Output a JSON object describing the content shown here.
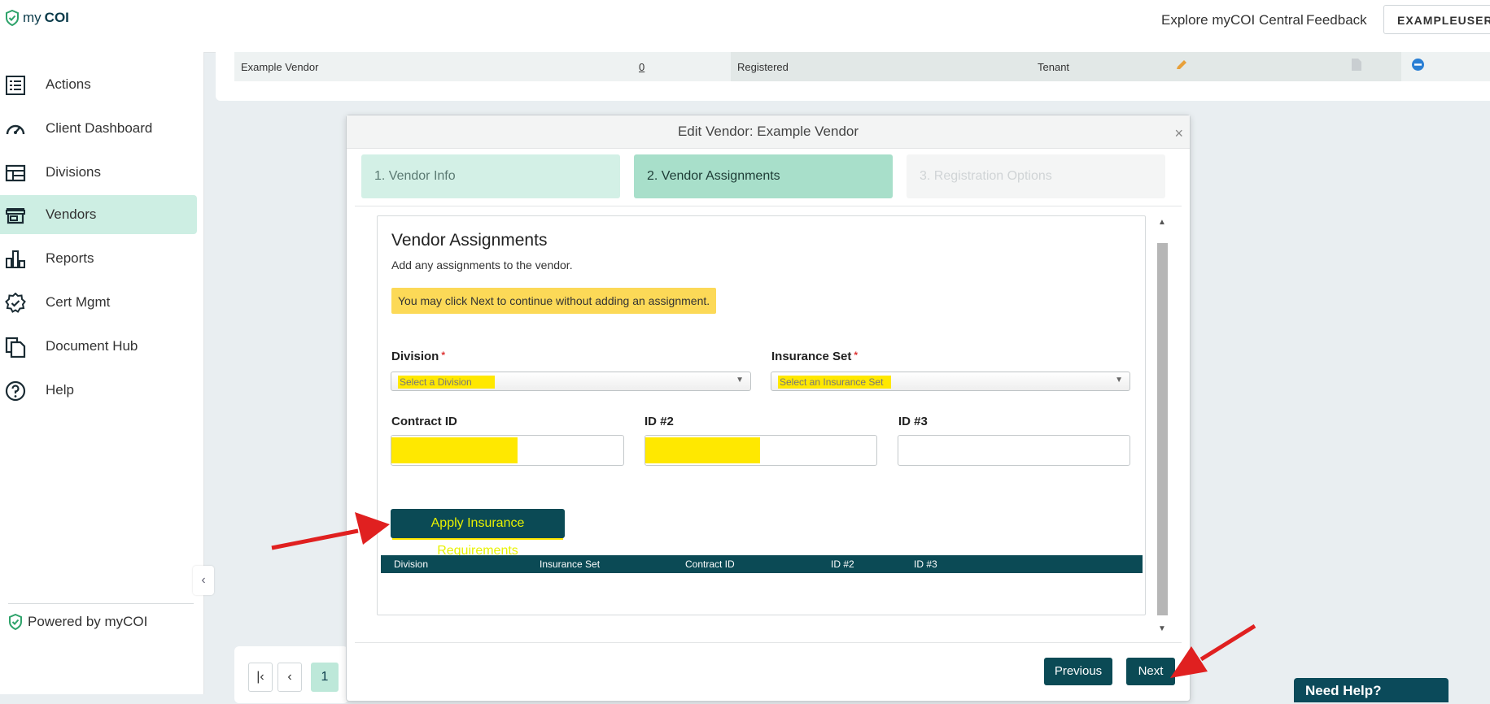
{
  "header": {
    "logo_prefix": "my",
    "logo_bold": "COI",
    "explore_link": "Explore myCOI Central",
    "feedback_link": "Feedback",
    "user_button": "EXAMPLEUSER"
  },
  "sidebar": {
    "items": [
      {
        "label": "Actions",
        "icon": "list-icon"
      },
      {
        "label": "Client Dashboard",
        "icon": "gauge-icon"
      },
      {
        "label": "Divisions",
        "icon": "layout-icon"
      },
      {
        "label": "Vendors",
        "icon": "store-icon",
        "active": true
      },
      {
        "label": "Reports",
        "icon": "bar-chart-icon"
      },
      {
        "label": "Cert Mgmt",
        "icon": "badge-check-icon"
      },
      {
        "label": "Document Hub",
        "icon": "documents-icon"
      },
      {
        "label": "Help",
        "icon": "help-icon"
      }
    ],
    "powered_by": "Powered by myCOI"
  },
  "background_row": {
    "vendor": "Example Vendor",
    "count": "0",
    "status": "Registered",
    "type": "Tenant"
  },
  "pagination": {
    "current_page": "1"
  },
  "need_help": "Need Help?",
  "modal": {
    "title": "Edit Vendor: Example Vendor",
    "close": "×",
    "steps": [
      {
        "label": "1. Vendor Info",
        "state": "done"
      },
      {
        "label": "2. Vendor Assignments",
        "state": "active"
      },
      {
        "label": "3. Registration Options",
        "state": "disabled"
      }
    ],
    "section_title": "Vendor Assignments",
    "section_subtitle": "Add any assignments to the vendor.",
    "notice": "You may click Next to continue without adding an assignment.",
    "division": {
      "label": "Division",
      "required": "*",
      "placeholder": "Select a Division"
    },
    "insurance_set": {
      "label": "Insurance Set",
      "required": "*",
      "placeholder": "Select an Insurance Set"
    },
    "contract_id": {
      "label": "Contract ID",
      "value": ""
    },
    "id2": {
      "label": "ID #2",
      "value": ""
    },
    "id3": {
      "label": "ID #3",
      "value": ""
    },
    "apply_button": "Apply Insurance Requirements",
    "table_headers": [
      "Division",
      "Insurance Set",
      "Contract ID",
      "ID #2",
      "ID #3"
    ],
    "previous_button": "Previous",
    "next_button": "Next"
  },
  "colors": {
    "brand_dark": "#0b4a55",
    "active_nav": "#cdeee3",
    "highlight": "#ffe800",
    "notice": "#fcd957",
    "annotation_arrow": "#e02020"
  }
}
